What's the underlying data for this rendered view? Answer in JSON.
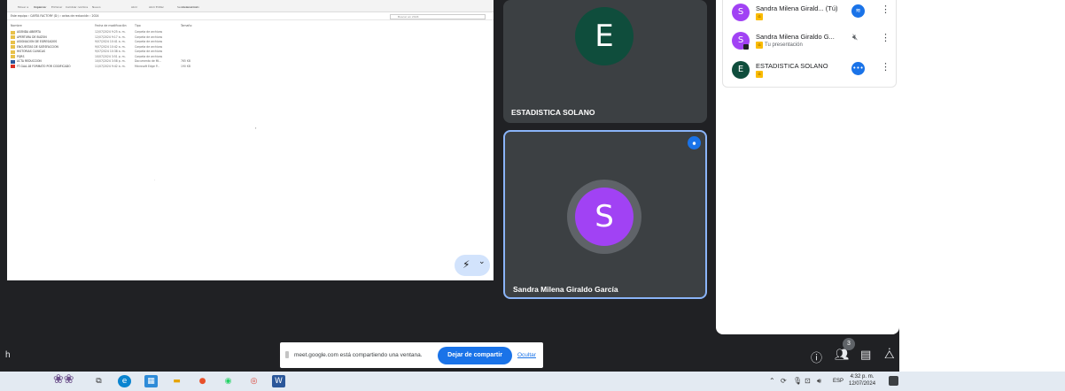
{
  "explorer": {
    "ribbon_groups": [
      "Organizar",
      "Nuevo",
      "Abrir",
      "Seleccionar"
    ],
    "ribbon_labels": [
      "Mover a",
      "Copiar a",
      "Eliminar",
      "Cambiar nombre",
      "Abrir",
      "Editar",
      "Historial",
      "Seleccionar todo",
      "No seleccionar nada"
    ],
    "address_path": "Este equipo  ›  CARTA FACTORY (D:)  ›  actas de reducción  ›  2024",
    "search_placeholder": "Buscar en 2024",
    "columns": [
      "Nombre",
      "Fecha de modificación",
      "Tipo",
      "Tamaño"
    ],
    "files": [
      {
        "name": "AGENDA ABIERTA",
        "date": "12/07/2024 9:25 a. m.",
        "type": "Carpeta de archivos",
        "size": "",
        "kind": "folder"
      },
      {
        "name": "APERTURA DE BUZON",
        "date": "12/07/2024 9:17 a. m.",
        "type": "Carpeta de archivos",
        "size": "",
        "kind": "folder"
      },
      {
        "name": "ASIGNACION DE EGRESADOS",
        "date": "9/07/2024 10:41 a. m.",
        "type": "Carpeta de archivos",
        "size": "",
        "kind": "folder"
      },
      {
        "name": "ENCUESTAS DE SATISFACCION",
        "date": "9/07/2024 10:42 a. m.",
        "type": "Carpeta de archivos",
        "size": "",
        "kind": "folder"
      },
      {
        "name": "HISTORIAS CLINICAS",
        "date": "9/07/2024 10:38 a. m.",
        "type": "Carpeta de archivos",
        "size": "",
        "kind": "folder"
      },
      {
        "name": "PQRS",
        "date": "10/07/2024 3:51 p. m.",
        "type": "Carpeta de archivos",
        "size": "",
        "kind": "folder"
      },
      {
        "name": "ACTA REDUCCION",
        "date": "10/07/2024 3:58 p. m.",
        "type": "Documento de Mi...",
        "size": "765 KB",
        "kind": "doc"
      },
      {
        "name": "FT-GAA-18 FORMATO POR CODIFICADO",
        "date": "11/07/2024 9:42 a. m.",
        "type": "Microsoft Edge P...",
        "size": "190 KB",
        "kind": "pdf"
      }
    ]
  },
  "meet": {
    "tiles": [
      {
        "initial": "E",
        "name": "ESTADISTICA SOLANO"
      },
      {
        "initial": "S",
        "name": "Sandra Milena Giraldo García",
        "speaking_icon": "audio-wave-icon"
      }
    ],
    "participants": [
      {
        "initial": "S",
        "name": "Sandra Milena Girald... (Tú)",
        "sub": "",
        "badge": "G",
        "status": "audio-wave-icon",
        "color": "#a142f4"
      },
      {
        "initial": "S",
        "name": "Sandra Milena Giraldo G...",
        "sub": "Tu presentación",
        "badge": "G",
        "status": "mic-off-icon",
        "color": "#a142f4"
      },
      {
        "initial": "E",
        "name": "ESTADISTICA SOLANO",
        "sub": "",
        "badge": "G",
        "status": "more-dots-icon",
        "color": "#0f4d3c"
      }
    ],
    "share_bar": {
      "text": "meet.google.com está compartiendo una ventana.",
      "stop_label": "Dejar de compartir",
      "hide_label": "Ocultar"
    },
    "people_count": "3",
    "bottom_letter": "h"
  },
  "taskbar": {
    "language": "ESP",
    "time": "4:32 p. m.",
    "date": "12/07/2024"
  }
}
